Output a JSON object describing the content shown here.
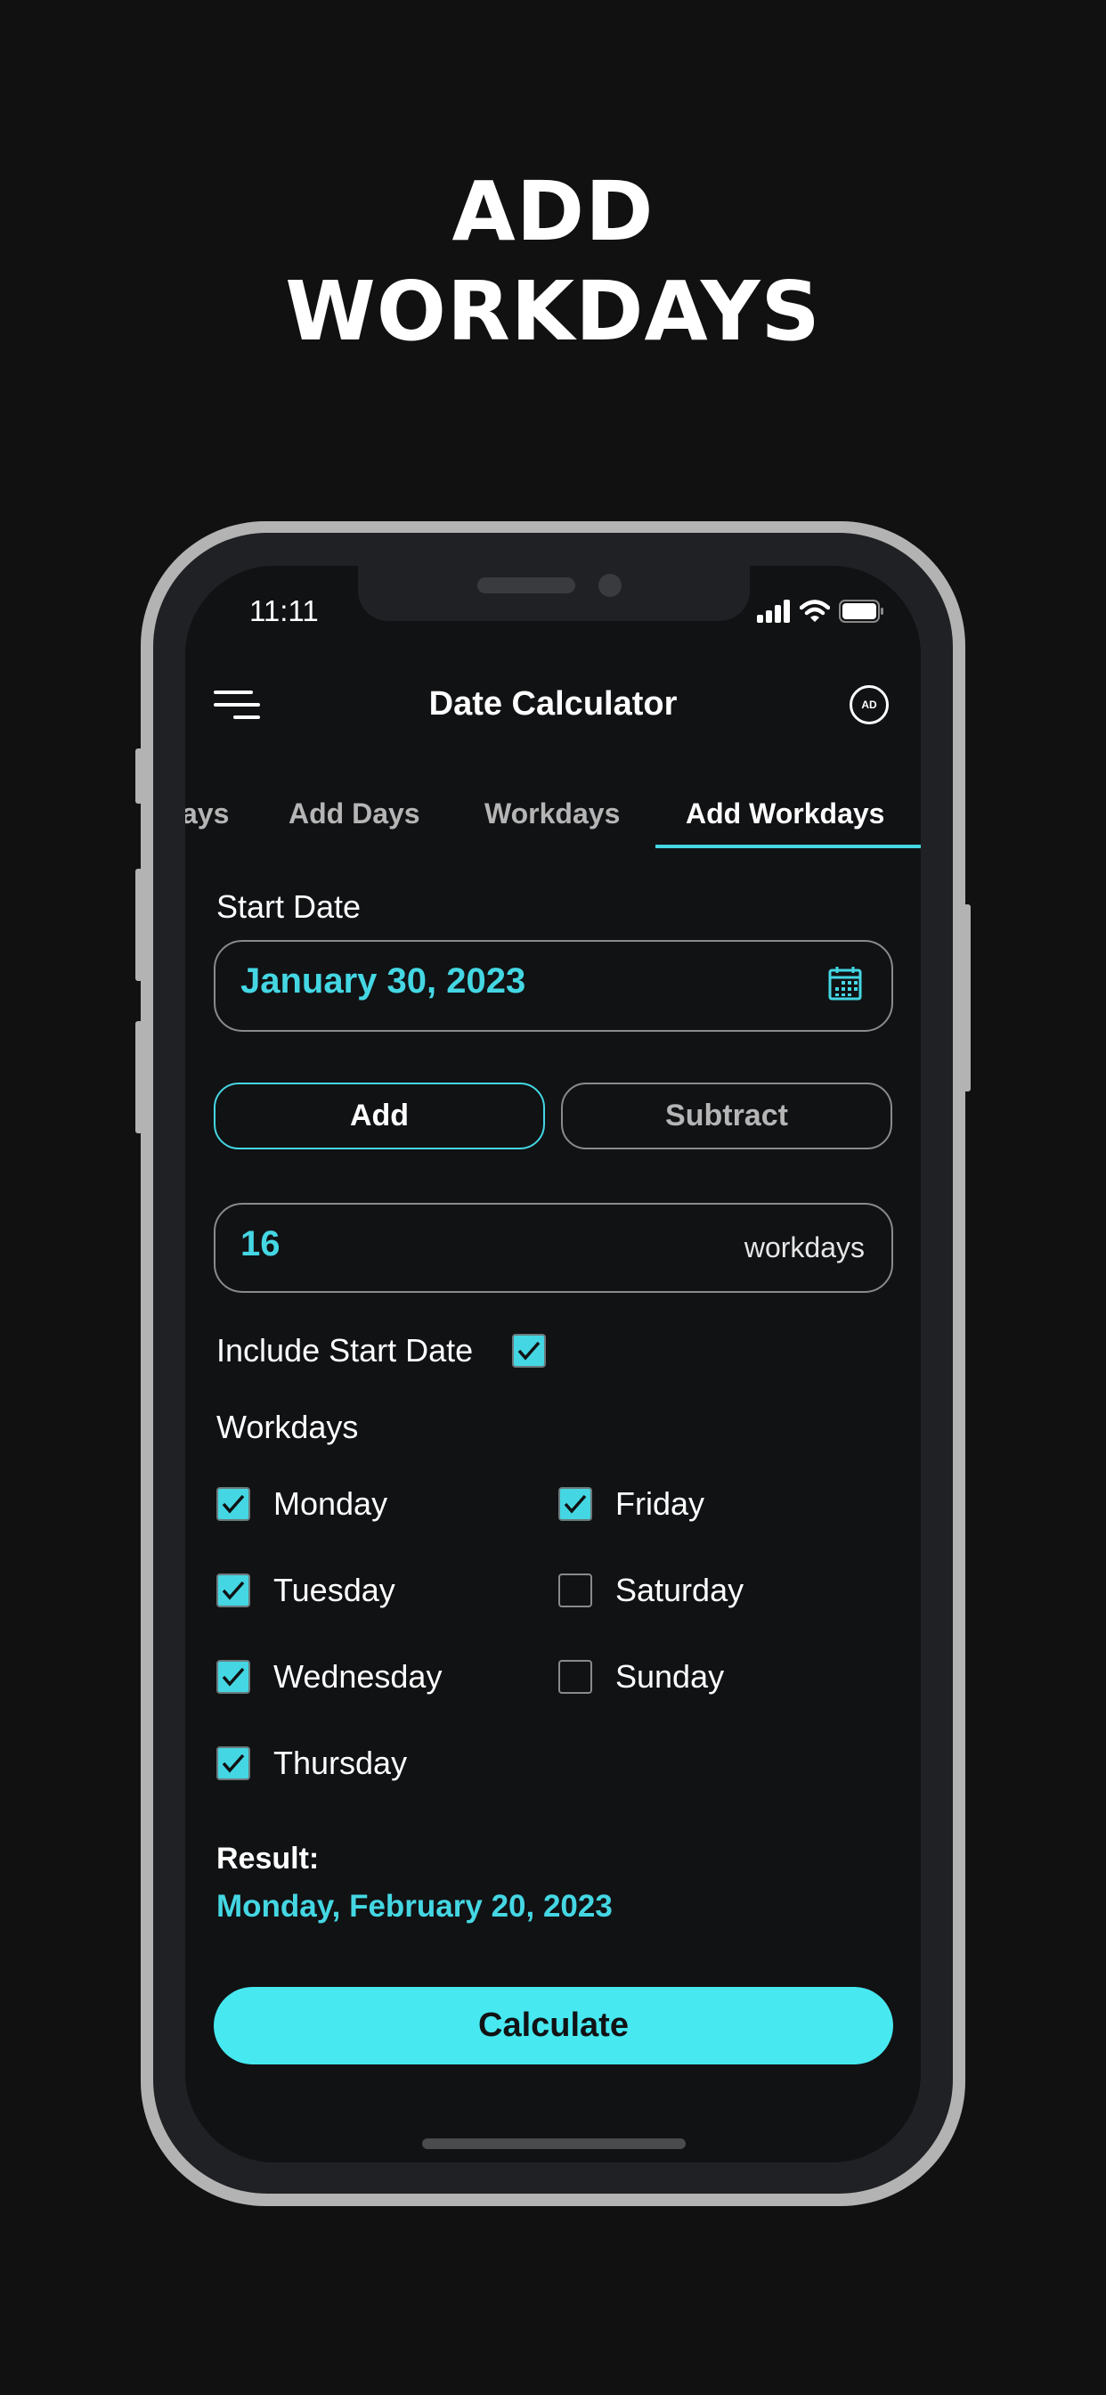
{
  "promo": {
    "title_line1": "ADD",
    "title_line2": "WORKDAYS"
  },
  "status_bar": {
    "time": "11:11",
    "icons": [
      "cellular-signal-icon",
      "wifi-icon",
      "battery-icon"
    ]
  },
  "header": {
    "title": "Date Calculator",
    "menu_icon": "hamburger-menu-icon",
    "ad_badge": "AD"
  },
  "tabs": [
    {
      "label": "ays",
      "active": false
    },
    {
      "label": "Add Days",
      "active": false
    },
    {
      "label": "Workdays",
      "active": false
    },
    {
      "label": "Add Workdays",
      "active": true
    }
  ],
  "form": {
    "start_date_label": "Start Date",
    "start_date_value": "January 30, 2023",
    "calendar_icon": "calendar-icon",
    "operation": {
      "add_label": "Add",
      "subtract_label": "Subtract",
      "selected": "Add"
    },
    "amount_value": "16",
    "amount_unit": "workdays",
    "include_start_label": "Include Start Date",
    "include_start_checked": true,
    "workdays_label": "Workdays",
    "days": [
      {
        "label": "Monday",
        "checked": true
      },
      {
        "label": "Tuesday",
        "checked": true
      },
      {
        "label": "Wednesday",
        "checked": true
      },
      {
        "label": "Thursday",
        "checked": true
      },
      {
        "label": "Friday",
        "checked": true
      },
      {
        "label": "Saturday",
        "checked": false
      },
      {
        "label": "Sunday",
        "checked": false
      }
    ]
  },
  "result": {
    "label": "Result:",
    "value": "Monday, February 20, 2023"
  },
  "calculate_label": "Calculate",
  "colors": {
    "accent": "#44d7e3",
    "button_fill": "#47e8f0",
    "background": "#111111",
    "screen": "#111214",
    "frame": "#b3b3b3"
  }
}
